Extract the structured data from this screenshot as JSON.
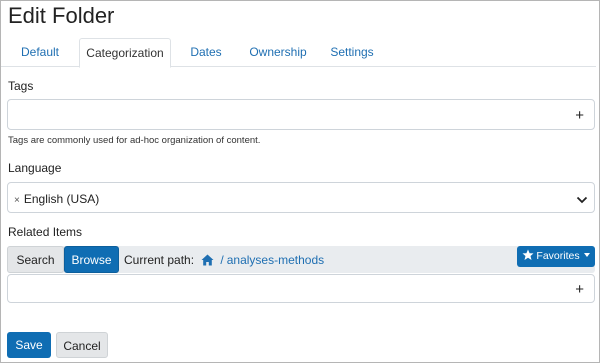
{
  "page": {
    "title": "Edit Folder"
  },
  "tabs": [
    {
      "label": "Default"
    },
    {
      "label": "Categorization"
    },
    {
      "label": "Dates"
    },
    {
      "label": "Ownership"
    },
    {
      "label": "Settings"
    }
  ],
  "active_tab": "Categorization",
  "tags": {
    "label": "Tags",
    "add_symbol": "+",
    "help": "Tags are commonly used for ad-hoc organization of content."
  },
  "language": {
    "label": "Language",
    "remove_symbol": "×",
    "value": "English (USA)"
  },
  "related": {
    "label": "Related Items",
    "search_label": "Search",
    "browse_label": "Browse",
    "path_label": "Current path:",
    "path_separator": "/",
    "path_segment": "analyses-methods",
    "favorites_label": "Favorites",
    "add_symbol": "+"
  },
  "actions": {
    "save_label": "Save",
    "cancel_label": "Cancel"
  },
  "colors": {
    "primary": "#0f6db3",
    "link": "#1f6fb2",
    "bar": "#e9ecef"
  },
  "icons": [
    "plus-icon",
    "chevron-down-icon",
    "home-icon",
    "star-icon",
    "caret-down-icon"
  ]
}
